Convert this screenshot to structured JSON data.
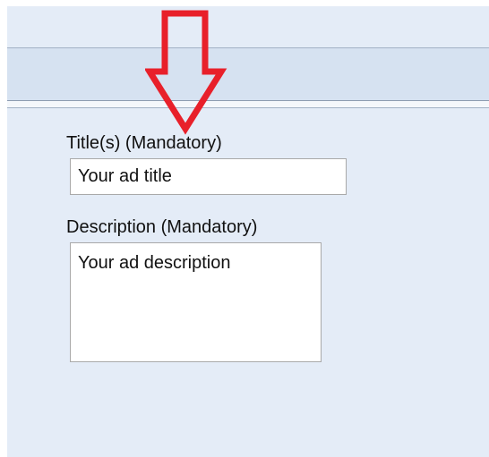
{
  "form": {
    "title_label": "Title(s) (Mandatory)",
    "title_value": "Your ad title",
    "description_label": "Description (Mandatory)",
    "description_value": "Your ad description"
  },
  "annotation": {
    "arrow_icon": "down-arrow-icon",
    "arrow_color": "#e8202a"
  },
  "colors": {
    "panel_background": "#e4ecf7",
    "header_strip": "#d6e2f1",
    "border": "#a9a9a9"
  }
}
